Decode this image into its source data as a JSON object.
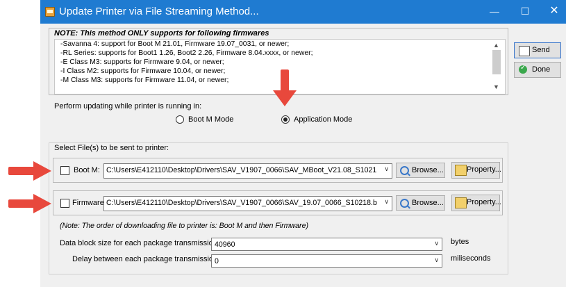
{
  "window": {
    "title": "Update Printer via File Streaming Method...",
    "minimize_glyph": "—",
    "maximize_glyph": "☐",
    "close_glyph": "✕",
    "titlebar_color": "#1f7bd1"
  },
  "note": {
    "heading": "NOTE:  This method ONLY supports for following firmwares",
    "lines": [
      "-Savanna 4: support for Boot M 21.01, Firmware 19.07_0031, or newer;",
      "-RL Series: supports  for Boot1 1.26, Boot2 2.26, Firmware 8.04.xxxx, or newer;",
      "-E Class M3: supports for Firmware 9.04, or newer;",
      "-I Class M2: supports for Firmware 10.04, or newer;",
      "-M Class M3: supports for Firmware 11.04, or newer;"
    ]
  },
  "mode": {
    "label": "Perform updating while printer is running in:",
    "options": [
      {
        "label": "Boot M Mode",
        "selected": false
      },
      {
        "label": "Application Mode",
        "selected": true
      }
    ]
  },
  "files": {
    "group_label": "Select File(s) to be sent to printer:",
    "bootm": {
      "label": "Boot M:",
      "checked": false,
      "path": "C:\\Users\\E412110\\Desktop\\Drivers\\SAV_V1907_0066\\SAV_MBoot_V21.08_S1021"
    },
    "firmware": {
      "label": "Firmware:",
      "checked": false,
      "path": "C:\\Users\\E412110\\Desktop\\Drivers\\SAV_V1907_0066\\SAV_19.07_0066_S10218.b"
    },
    "browse_label": "Browse...",
    "property_label": "Property...",
    "order_note": "(Note: The order of downloading file to printer is: Boot M and then Firmware)"
  },
  "transfer": {
    "block_label": "Data block size for each package transmission:",
    "block_value": "40960",
    "block_unit": "bytes",
    "delay_label": "Delay between each package transmission:",
    "delay_value": "0",
    "delay_unit": "miliseconds"
  },
  "actions": {
    "send_label": "Send",
    "done_label": "Done"
  },
  "annotation": {
    "arrow_color": "#e8483c"
  }
}
